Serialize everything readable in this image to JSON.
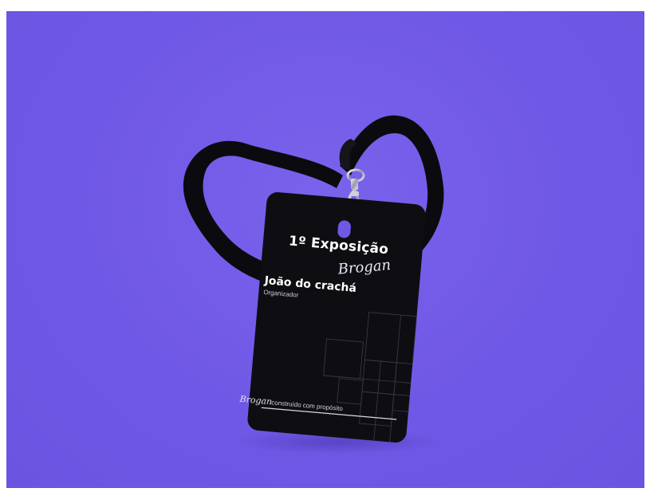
{
  "badge": {
    "title": "1º Exposição",
    "brand_script": "Brogan",
    "holder_name": "João do crachá",
    "holder_role": "Organizador",
    "footer_brand": "Brogan",
    "footer_tagline": "construído com propósito"
  },
  "colors": {
    "background": "#7058e6",
    "badge": "#0e0e12",
    "lanyard": "#0b0b0f",
    "text": "#ffffff",
    "clip": "#c9c9d2"
  }
}
